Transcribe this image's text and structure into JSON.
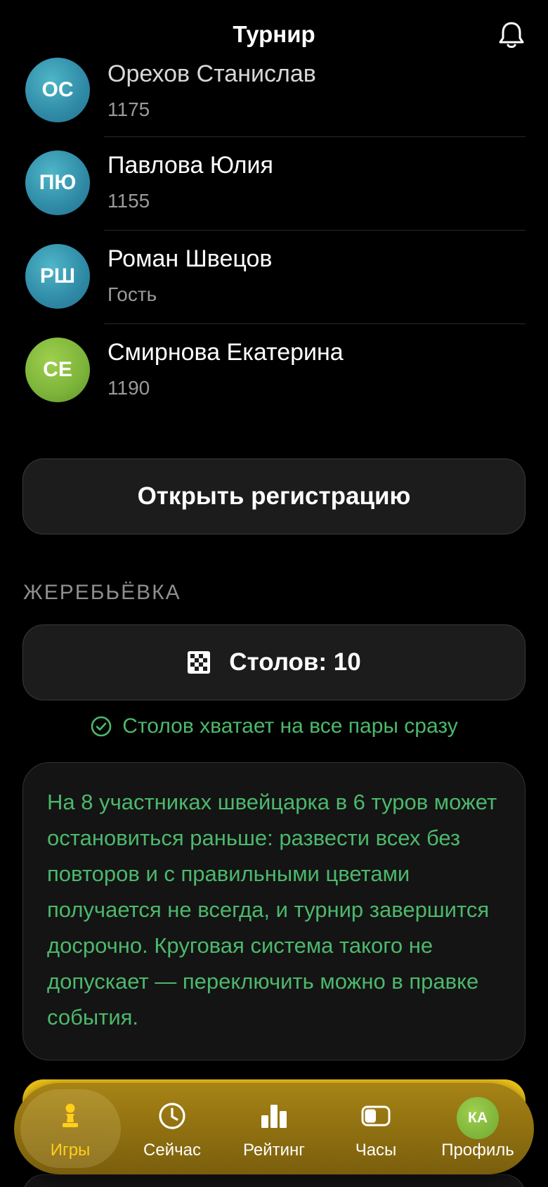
{
  "header": {
    "title": "Турнир"
  },
  "players": [
    {
      "initials": "ОС",
      "name": "Орехов Станислав",
      "sub": "1175",
      "color": "blue"
    },
    {
      "initials": "ПЮ",
      "name": "Павлова Юлия",
      "sub": "1155",
      "color": "blue"
    },
    {
      "initials": "РШ",
      "name": "Роман Швецов",
      "sub": "Гость",
      "color": "blue"
    },
    {
      "initials": "СЕ",
      "name": "Смирнова Екатерина",
      "sub": "1190",
      "color": "green"
    }
  ],
  "registration": {
    "button_label": "Открыть регистрацию"
  },
  "draw": {
    "section_label": "ЖЕРЕБЬЁВКА",
    "tables_label": "Столов: 10",
    "status": "Столов хватает на все пары сразу",
    "note": "На 8 участниках швейцарка в 6 туров может остановиться раньше: развести всех без повторов и с правильными цветами получается не всегда, и турнир завершится досрочно. Круговая система такого не допускает — переключить можно в правке события."
  },
  "tabbar": {
    "items": [
      {
        "label": "Игры",
        "icon": "pawn-icon",
        "active": true
      },
      {
        "label": "Сейчас",
        "icon": "clock-icon",
        "active": false
      },
      {
        "label": "Рейтинг",
        "icon": "bar-chart-icon",
        "active": false
      },
      {
        "label": "Часы",
        "icon": "chess-clock-icon",
        "active": false
      },
      {
        "label": "Профиль",
        "icon": "avatar",
        "active": false,
        "initials": "КА"
      }
    ]
  },
  "colors": {
    "accent": "#ffcf1a",
    "success": "#4cb86b",
    "tabbar": "#8e6f10"
  }
}
